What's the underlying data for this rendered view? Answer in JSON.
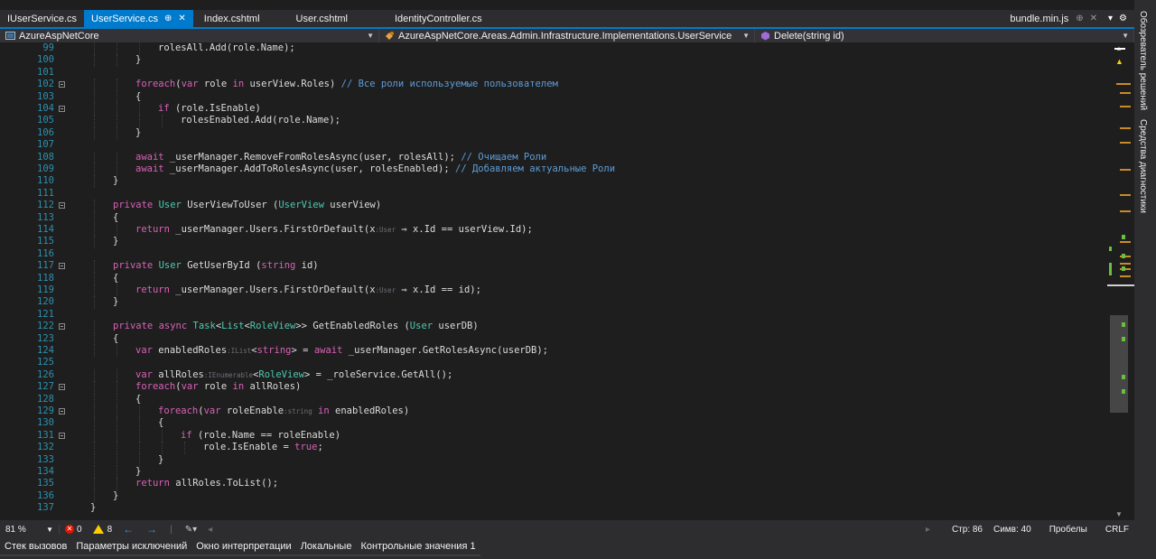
{
  "tabs": [
    {
      "label": "IUserService.cs",
      "active": false
    },
    {
      "label": "UserService.cs",
      "active": true,
      "pin_icon": "pin-icon",
      "close_icon": "close-icon"
    },
    {
      "label": "Index.cshtml",
      "active": false
    },
    {
      "label": "User.cshtml",
      "active": false
    },
    {
      "label": "IdentityController.cs",
      "active": false
    }
  ],
  "preview_tab": {
    "label": "bundle.min.js"
  },
  "navbar": {
    "project": "AzureAspNetCore",
    "type": "AzureAspNetCore.Areas.Admin.Infrastructure.Implementations.UserService",
    "member": "Delete(string id)"
  },
  "code_lines": [
    {
      "n": "99",
      "fold": false,
      "indent": 3,
      "t": "rolesAll.Add(role.Name);"
    },
    {
      "n": "100",
      "fold": false,
      "indent": 2,
      "t": "}"
    },
    {
      "n": "101",
      "fold": false,
      "indent": 0,
      "t": ""
    },
    {
      "n": "102",
      "fold": true,
      "indent": 2,
      "t": "foreach(var role in userView.Roles) // Все роли используемые пользователем"
    },
    {
      "n": "103",
      "fold": false,
      "indent": 2,
      "t": "{"
    },
    {
      "n": "104",
      "fold": true,
      "indent": 3,
      "t": "if (role.IsEnable)"
    },
    {
      "n": "105",
      "fold": false,
      "indent": 4,
      "t": "rolesEnabled.Add(role.Name);"
    },
    {
      "n": "106",
      "fold": false,
      "indent": 2,
      "t": "}"
    },
    {
      "n": "107",
      "fold": false,
      "indent": 0,
      "t": ""
    },
    {
      "n": "108",
      "fold": false,
      "indent": 2,
      "t": "await _userManager.RemoveFromRolesAsync(user, rolesAll); // Очищаем Роли"
    },
    {
      "n": "109",
      "fold": false,
      "indent": 2,
      "t": "await _userManager.AddToRolesAsync(user, rolesEnabled); // Добавляем актуальные Роли"
    },
    {
      "n": "110",
      "fold": false,
      "indent": 1,
      "t": "}"
    },
    {
      "n": "111",
      "fold": false,
      "indent": 0,
      "t": ""
    },
    {
      "n": "112",
      "fold": true,
      "indent": 1,
      "t": "private User UserViewToUser (UserView userView)"
    },
    {
      "n": "113",
      "fold": false,
      "indent": 1,
      "t": "{"
    },
    {
      "n": "114",
      "fold": false,
      "indent": 2,
      "t": "return _userManager.Users.FirstOrDefault(x:User ⇒ x.Id == userView.Id);"
    },
    {
      "n": "115",
      "fold": false,
      "indent": 1,
      "t": "}"
    },
    {
      "n": "116",
      "fold": false,
      "indent": 0,
      "t": ""
    },
    {
      "n": "117",
      "fold": true,
      "indent": 1,
      "t": "private User GetUserById (string id)"
    },
    {
      "n": "118",
      "fold": false,
      "indent": 1,
      "t": "{"
    },
    {
      "n": "119",
      "fold": false,
      "indent": 2,
      "t": "return _userManager.Users.FirstOrDefault(x:User ⇒ x.Id == id);"
    },
    {
      "n": "120",
      "fold": false,
      "indent": 1,
      "t": "}"
    },
    {
      "n": "121",
      "fold": false,
      "indent": 0,
      "t": ""
    },
    {
      "n": "122",
      "fold": true,
      "indent": 1,
      "t": "private async Task<List<RoleView>> GetEnabledRoles (User userDB)"
    },
    {
      "n": "123",
      "fold": false,
      "indent": 1,
      "t": "{"
    },
    {
      "n": "124",
      "fold": false,
      "indent": 2,
      "t": "var enabledRoles:IList<string> = await _userManager.GetRolesAsync(userDB);"
    },
    {
      "n": "125",
      "fold": false,
      "indent": 0,
      "t": ""
    },
    {
      "n": "126",
      "fold": false,
      "indent": 2,
      "t": "var allRoles:IEnumerable<RoleView> = _roleService.GetAll();"
    },
    {
      "n": "127",
      "fold": true,
      "indent": 2,
      "t": "foreach(var role in allRoles)"
    },
    {
      "n": "128",
      "fold": false,
      "indent": 2,
      "t": "{"
    },
    {
      "n": "129",
      "fold": true,
      "indent": 3,
      "t": "foreach(var roleEnable:string in enabledRoles)"
    },
    {
      "n": "130",
      "fold": false,
      "indent": 3,
      "t": "{"
    },
    {
      "n": "131",
      "fold": true,
      "indent": 4,
      "t": "if (role.Name == roleEnable)"
    },
    {
      "n": "132",
      "fold": false,
      "indent": 5,
      "t": "role.IsEnable = true;"
    },
    {
      "n": "133",
      "fold": false,
      "indent": 3,
      "t": "}"
    },
    {
      "n": "134",
      "fold": false,
      "indent": 2,
      "t": "}"
    },
    {
      "n": "135",
      "fold": false,
      "indent": 2,
      "t": "return allRoles.ToList();"
    },
    {
      "n": "136",
      "fold": false,
      "indent": 1,
      "t": "}"
    },
    {
      "n": "137",
      "fold": false,
      "indent": 0,
      "t": "}"
    }
  ],
  "statusbar": {
    "zoom": "81 %",
    "errors": "0",
    "warnings": "8",
    "line": "Стр: 86",
    "col": "Симв: 40",
    "whitespace": "Пробелы",
    "eol": "CRLF"
  },
  "right_dock": {
    "solution_explorer": "Обозреватель решений",
    "diagnostics": "Средства диагностики"
  },
  "bottom_tabs": [
    "Стек вызовов",
    "Параметры исключений",
    "Окно интерпретации",
    "Локальные",
    "Контрольные значения 1"
  ],
  "colors": {
    "accent": "#007acc",
    "keyword": "#d861b6",
    "type": "#4ec9b0",
    "comment": "#57a64a",
    "line_number": "#2b91af"
  }
}
